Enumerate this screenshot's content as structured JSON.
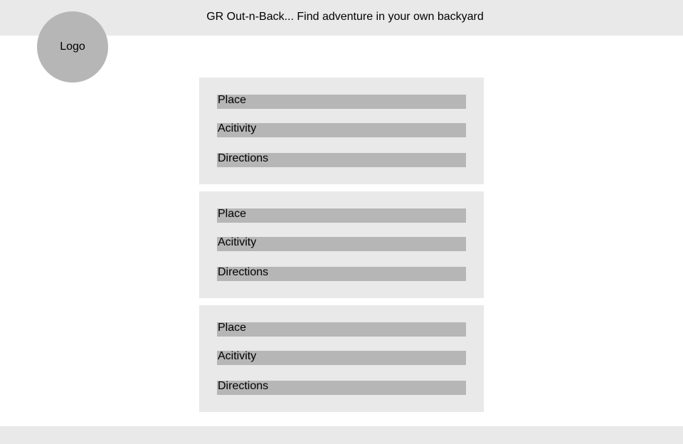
{
  "header": {
    "title": "GR Out-n-Back... Find adventure in your own backyard"
  },
  "logo": {
    "label": "Logo"
  },
  "cards": [
    {
      "place": "Place",
      "activity": "Acitivity",
      "directions": "Directions"
    },
    {
      "place": "Place",
      "activity": "Acitivity",
      "directions": "Directions"
    },
    {
      "place": "Place",
      "activity": "Acitivity",
      "directions": "Directions"
    }
  ],
  "colors": {
    "bar_background": "#e9e9e9",
    "placeholder_gray": "#b6b6b6",
    "page_background": "#ffffff"
  }
}
